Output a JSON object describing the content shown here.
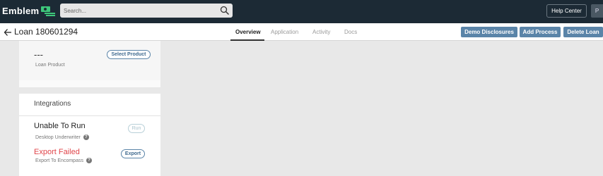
{
  "topbar": {
    "logo_text": "Emblem",
    "search_placeholder": "Search...",
    "help_label": "Help Center",
    "avatar_initial": "P"
  },
  "loan": {
    "title": "Loan 180601294"
  },
  "tabs": [
    {
      "label": "Overview",
      "active": true
    },
    {
      "label": "Application",
      "active": false
    },
    {
      "label": "Activity",
      "active": false
    },
    {
      "label": "Docs",
      "active": false
    }
  ],
  "actions": {
    "demo_disclosures": "Demo Disclosures",
    "add_process": "Add Process",
    "delete_loan": "Delete Loan"
  },
  "product_card": {
    "value": "---",
    "label": "Loan Product",
    "select_button": "Select Product"
  },
  "integrations": {
    "title": "Integrations",
    "items": [
      {
        "status": "Unable To Run",
        "status_color": "#222222",
        "name": "Desktop Underwriter",
        "button": "Run",
        "button_enabled": false
      },
      {
        "status": "Export Failed",
        "status_color": "#e0454a",
        "name": "Export To Encompass",
        "button": "Export",
        "button_enabled": true
      }
    ]
  },
  "colors": {
    "topbar": "#1c2a35",
    "accent": "#5a84a8",
    "brand_green": "#3ec77b",
    "error": "#e0454a"
  }
}
